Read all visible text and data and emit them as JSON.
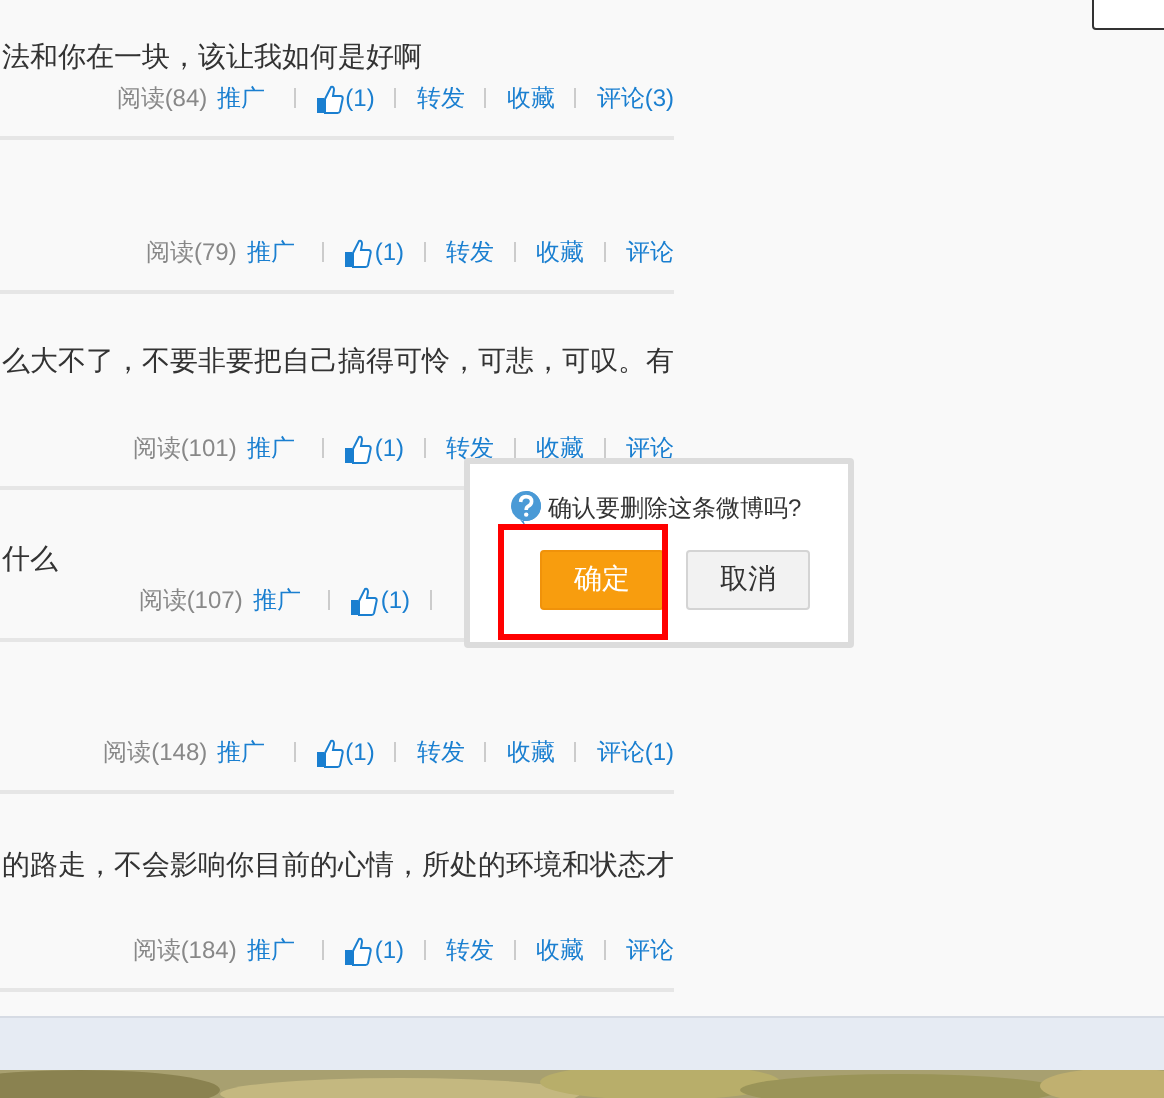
{
  "posts": [
    {
      "text": "法和你在一块，该让我如何是好啊",
      "read": "阅读(84)",
      "promote": "推广",
      "likes": "(1)",
      "forward": "转发",
      "favorite": "收藏",
      "comment": "评论(3)"
    },
    {
      "read": "阅读(79)",
      "promote": "推广",
      "likes": "(1)",
      "forward": "转发",
      "favorite": "收藏",
      "comment": "评论"
    },
    {
      "text": "么大不了，不要非要把自己搞得可怜，可悲，可叹。有",
      "read": "阅读(101)",
      "promote": "推广",
      "likes": "(1)",
      "forward": "转发",
      "favorite": "收藏",
      "comment": "评论"
    },
    {
      "text": "什么",
      "read": "阅读(107)",
      "promote": "推广",
      "likes": "(1)"
    },
    {
      "read": "阅读(148)",
      "promote": "推广",
      "likes": "(1)",
      "forward": "转发",
      "favorite": "收藏",
      "comment": "评论(1)"
    },
    {
      "text": "的路走，不会影响你目前的心情，所处的环境和状态才",
      "read": "阅读(184)",
      "promote": "推广",
      "likes": "(1)",
      "forward": "转发",
      "favorite": "收藏",
      "comment": "评论"
    }
  ],
  "dialog": {
    "message": "确认要删除这条微博吗?",
    "buttons": [
      {
        "label": "确定",
        "kind": "primary"
      },
      {
        "label": "取消",
        "kind": "secondary"
      }
    ]
  }
}
